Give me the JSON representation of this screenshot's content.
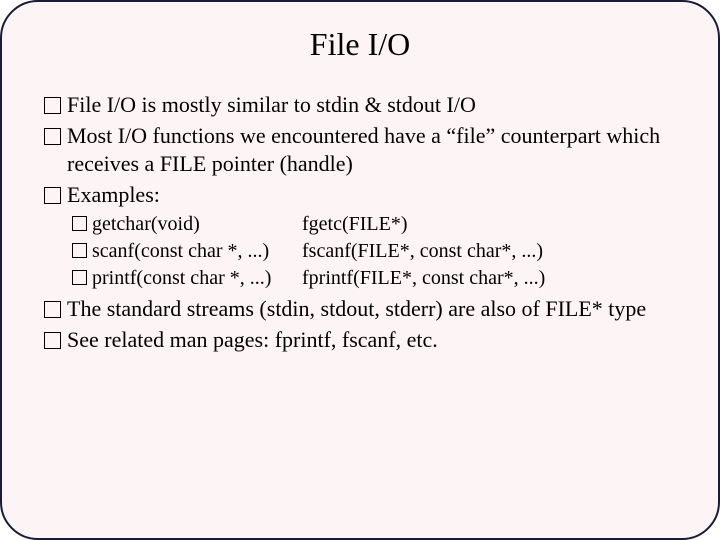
{
  "title": "File I/O",
  "bullets": {
    "b1": "File I/O is mostly similar to stdin & stdout I/O",
    "b2": "Most I/O functions we encountered have a “file” counterpart which receives a FILE pointer (handle)",
    "b3": "Examples:",
    "b4": "The standard streams (stdin, stdout, stderr) are also of FILE* type",
    "b5": "See related man pages: fprintf, fscanf, etc."
  },
  "examples": [
    {
      "l": "getchar(void)",
      "r": "fgetc(FILE*)"
    },
    {
      "l": "scanf(const char *, ...)",
      "r": "fscanf(FILE*, const char*, ...)"
    },
    {
      "l": "printf(const char *, ...)",
      "r": "fprintf(FILE*, const char*, ...)"
    }
  ]
}
